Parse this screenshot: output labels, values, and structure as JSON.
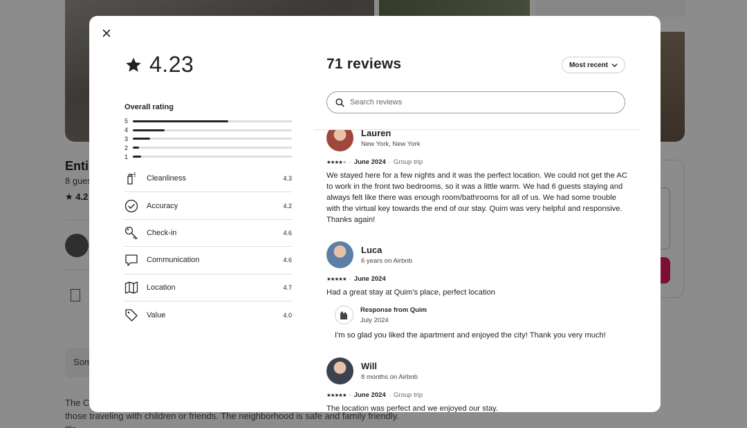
{
  "background": {
    "listing_title": "Enti",
    "guests": "8 gues",
    "rating": "★ 4.2",
    "some_label": "Som",
    "description": "The C... bathrooms flat, located at the heart of Barcelona's City Center, perfect for those traveling with children or friends. The neighborhood is safe and family friendly. It's"
  },
  "modal": {
    "close_icon": "close-icon",
    "overall": {
      "rating": "4.23",
      "label": "Overall rating",
      "distribution": [
        {
          "stars": "5",
          "fraction": 0.6
        },
        {
          "stars": "4",
          "fraction": 0.2
        },
        {
          "stars": "3",
          "fraction": 0.11
        },
        {
          "stars": "2",
          "fraction": 0.04
        },
        {
          "stars": "1",
          "fraction": 0.05
        }
      ]
    },
    "categories": [
      {
        "icon": "spray-bottle-icon",
        "name": "Cleanliness",
        "value": "4.3"
      },
      {
        "icon": "check-circle-icon",
        "name": "Accuracy",
        "value": "4.2"
      },
      {
        "icon": "key-icon",
        "name": "Check-in",
        "value": "4.6"
      },
      {
        "icon": "chat-bubble-icon",
        "name": "Communication",
        "value": "4.6"
      },
      {
        "icon": "map-icon",
        "name": "Location",
        "value": "4.7"
      },
      {
        "icon": "tag-icon",
        "name": "Value",
        "value": "4.0"
      }
    ],
    "reviews_title": "71 reviews",
    "sort_label": "Most recent",
    "search_placeholder": "Search reviews",
    "reviews": [
      {
        "name": "Lauren",
        "subtitle": "New York, New York",
        "stars": 4,
        "date": "June 2024",
        "trip": "Group trip",
        "avatar_color": "#a0473d",
        "text": "We stayed here for a few nights and it was the perfect location. We could not get the AC to work in the front two bedrooms, so it was a little warm. We had 6 guests staying and always felt like there was enough room/bathrooms for all of us. We had some trouble with the virtual key towards the end of our stay. Quim was very helpful and responsive. Thanks again!"
      },
      {
        "name": "Luca",
        "subtitle": "6 years on Airbnb",
        "stars": 5,
        "date": "June 2024",
        "trip": "",
        "avatar_color": "#5b7fa6",
        "text": "Had a great stay at Quim's place, perfect location",
        "response": {
          "from": "Response from Quim",
          "date": "July 2024",
          "text": "I'm so glad you liked the apartment and enjoyed the city! Thank you very much!"
        }
      },
      {
        "name": "Will",
        "subtitle": "8 months on Airbnb",
        "stars": 5,
        "date": "June 2024",
        "trip": "Group trip",
        "avatar_color": "#3b4250",
        "text": "The location was perfect and we enjoyed our stay."
      }
    ]
  }
}
